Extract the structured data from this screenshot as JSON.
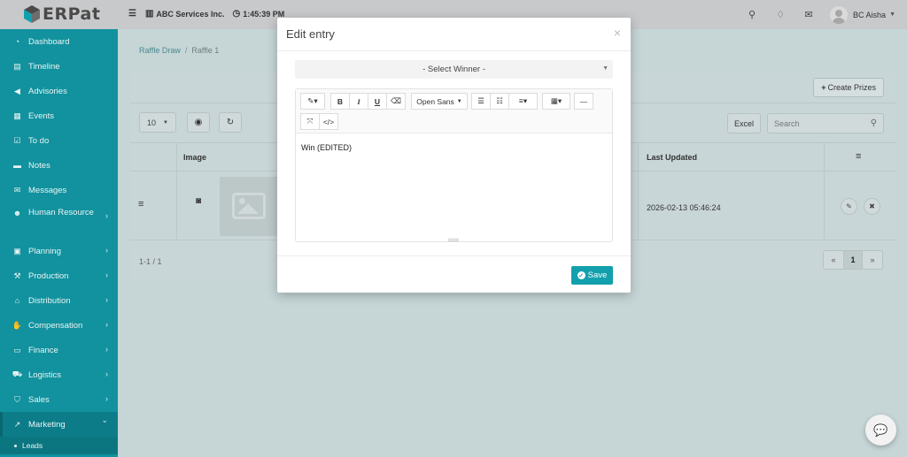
{
  "brand": {
    "name": "ERPat"
  },
  "topbar": {
    "company": "ABC Services Inc.",
    "time": "1:45:39 PM",
    "user_name": "BC Aisha",
    "icons": [
      "menu-icon",
      "building-icon",
      "clock-icon",
      "search-icon",
      "bell-icon",
      "envelope-icon",
      "avatar",
      "caret-down-icon"
    ]
  },
  "sidebar": {
    "items": [
      {
        "label": "Dashboard",
        "icon": "dashboard-icon",
        "glyph": "◔",
        "chevron": false
      },
      {
        "label": "Timeline",
        "icon": "timeline-icon",
        "glyph": "▤",
        "chevron": false
      },
      {
        "label": "Advisories",
        "icon": "bullhorn-icon",
        "glyph": "◀",
        "chevron": false
      },
      {
        "label": "Events",
        "icon": "calendar-icon",
        "glyph": "▦",
        "chevron": false
      },
      {
        "label": "To do",
        "icon": "checkbox-icon",
        "glyph": "☑",
        "chevron": false
      },
      {
        "label": "Notes",
        "icon": "note-icon",
        "glyph": "▬",
        "chevron": false
      },
      {
        "label": "Messages",
        "icon": "envelope-icon",
        "glyph": "✉",
        "chevron": false
      },
      {
        "label": "Human Resource",
        "icon": "users-icon",
        "glyph": "☻",
        "chevron": true
      },
      {
        "label": "Planning",
        "icon": "briefcase-icon",
        "glyph": "▣",
        "chevron": true
      },
      {
        "label": "Production",
        "icon": "gavel-icon",
        "glyph": "⚒",
        "chevron": true
      },
      {
        "label": "Distribution",
        "icon": "bank-icon",
        "glyph": "⌂",
        "chevron": true
      },
      {
        "label": "Compensation",
        "icon": "handshake-icon",
        "glyph": "✋",
        "chevron": true
      },
      {
        "label": "Finance",
        "icon": "money-icon",
        "glyph": "▭",
        "chevron": true
      },
      {
        "label": "Logistics",
        "icon": "truck-icon",
        "glyph": "⛟",
        "chevron": true
      },
      {
        "label": "Sales",
        "icon": "cart-icon",
        "glyph": "⛉",
        "chevron": true
      },
      {
        "label": "Marketing",
        "icon": "chart-line-icon",
        "glyph": "↗",
        "chevron": true,
        "active": true
      }
    ],
    "sub_items": [
      {
        "label": "Leads"
      }
    ],
    "chevron_right": "›",
    "chevron_down": "⌄"
  },
  "breadcrumb": {
    "parent": "Raffle Draw",
    "sep": "/",
    "current": "Raffle 1"
  },
  "panel": {
    "create_label": "Create Prizes",
    "page_size": "10",
    "excel_label": "Excel",
    "search_placeholder": "Search",
    "columns": {
      "image": "Image",
      "last_updated": "Last Updated"
    },
    "rows": [
      {
        "last_updated": "2026-02-13 05:46:24"
      }
    ],
    "count_text": "1-1 / 1",
    "pager": {
      "prev": "«",
      "page": "1",
      "next": "»"
    }
  },
  "modal": {
    "title": "Edit entry",
    "close": "×",
    "winner_select": "- Select Winner -",
    "font_label": "Open Sans",
    "content": "Win (EDITED)",
    "save_label": "Save"
  }
}
